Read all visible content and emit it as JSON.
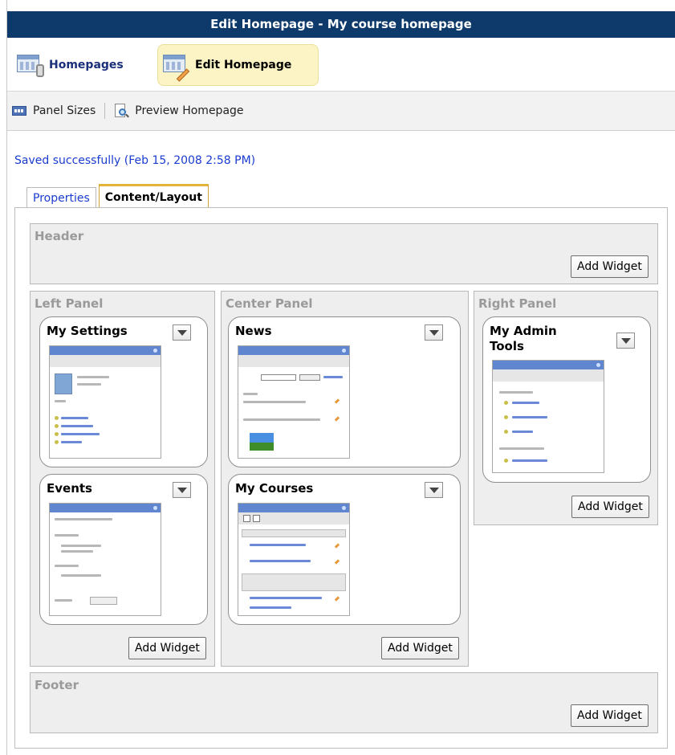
{
  "window": {
    "title": "Edit Homepage - My course homepage"
  },
  "nav": {
    "homepages_label": "Homepages",
    "edit_label": "Edit Homepage"
  },
  "toolbar": {
    "panel_sizes_label": "Panel Sizes",
    "preview_label": "Preview Homepage"
  },
  "status": {
    "message": "Saved successfully (Feb 15, 2008 2:58 PM)"
  },
  "tabs": [
    {
      "label": "Properties"
    },
    {
      "label": "Content/Layout",
      "active": true
    }
  ],
  "layout": {
    "add_widget_label": "Add Widget",
    "header": {
      "title": "Header"
    },
    "left": {
      "title": "Left Panel",
      "widgets": [
        {
          "title": "My Settings"
        },
        {
          "title": "Events"
        }
      ]
    },
    "center": {
      "title": "Center Panel",
      "widgets": [
        {
          "title": "News"
        },
        {
          "title": "My Courses"
        }
      ]
    },
    "right": {
      "title": "Right Panel",
      "widgets": [
        {
          "title": "My Admin Tools"
        }
      ]
    },
    "footer": {
      "title": "Footer"
    }
  },
  "icons": {
    "homepages": "homepages-icon",
    "edit_homepage": "edit-homepage-icon",
    "panel_sizes": "panel-sizes-icon",
    "preview": "preview-icon",
    "widget_menu": "chevron-down-icon"
  },
  "colors": {
    "title_bar": "#0d3a6a",
    "link": "#1a3ccf",
    "active_tab": "#e3b33a",
    "edit_highlight": "#fcf4c4"
  }
}
